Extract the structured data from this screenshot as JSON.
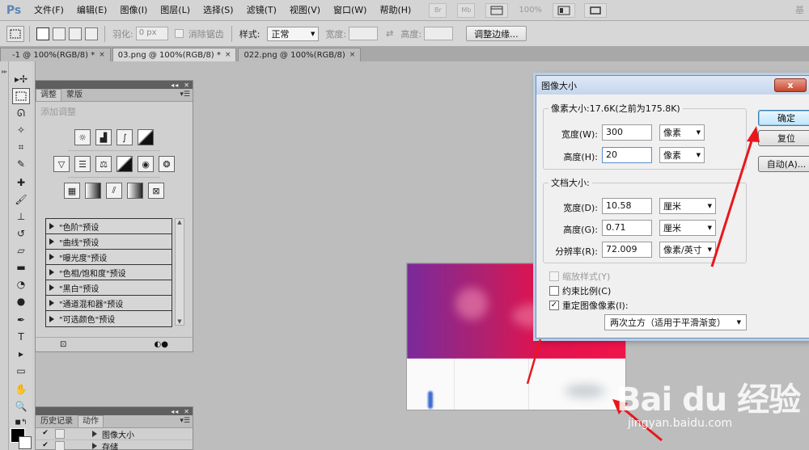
{
  "app": {
    "logo": "Ps",
    "menus": [
      "文件(F)",
      "编辑(E)",
      "图像(I)",
      "图层(L)",
      "选择(S)",
      "滤镜(T)",
      "视图(V)",
      "窗口(W)",
      "帮助(H)"
    ],
    "bridge_label": "Br",
    "minibridge_label": "Mb",
    "zoom": "100%",
    "right_label": "基"
  },
  "options_bar": {
    "feather_label": "羽化:",
    "feather_value": "0 px",
    "antialias_label": "消除锯齿",
    "style_label": "样式:",
    "style_value": "正常",
    "width_label": "宽度:",
    "height_label": "高度:",
    "refine_edge": "调整边缘..."
  },
  "doc_tabs": [
    {
      "label": "-1 @ 100%(RGB/8) *",
      "close": "×"
    },
    {
      "label": "03.png @ 100%(RGB/8) *",
      "close": "×"
    },
    {
      "label": "022.png @ 100%(RGB/8)",
      "close": "×"
    }
  ],
  "adjustments_panel": {
    "tab_adjust": "调整",
    "tab_masks": "蒙版",
    "title": "添加调整",
    "presets": [
      "\"色阶\"预设",
      "\"曲线\"预设",
      "\"曝光度\"预设",
      "\"色相/饱和度\"预设",
      "\"黑白\"预设",
      "\"通道混和器\"预设",
      "\"可选颜色\"预设"
    ]
  },
  "history_panel": {
    "tab_history": "历史记录",
    "tab_actions": "动作",
    "items": [
      "图像大小",
      "存储"
    ]
  },
  "dialog": {
    "title": "图像大小",
    "close_label": "x",
    "pixel_group": "像素大小:17.6K(之前为175.8K)",
    "width_label": "宽度(W):",
    "width_value": "300",
    "width_unit": "像素",
    "height_label": "高度(H):",
    "height_value": "20",
    "height_unit": "像素",
    "doc_group": "文档大小:",
    "doc_width_label": "宽度(D):",
    "doc_width_value": "10.58",
    "doc_width_unit": "厘米",
    "doc_height_label": "高度(G):",
    "doc_height_value": "0.71",
    "doc_height_unit": "厘米",
    "resolution_label": "分辨率(R):",
    "resolution_value": "72.009",
    "resolution_unit": "像素/英寸",
    "ok": "确定",
    "reset": "复位",
    "auto": "自动(A)...",
    "scale_styles": "缩放样式(Y)",
    "constrain": "约束比例(C)",
    "resample": "重定图像像素(I):",
    "resample_method": "两次立方（适用于平滑渐变）"
  },
  "watermark": {
    "logo": "Bai du 经验",
    "url": "jingyan.baidu.com"
  },
  "colors": {
    "annotation_red": "#e8171b",
    "dialog_border": "#6b8db8"
  }
}
